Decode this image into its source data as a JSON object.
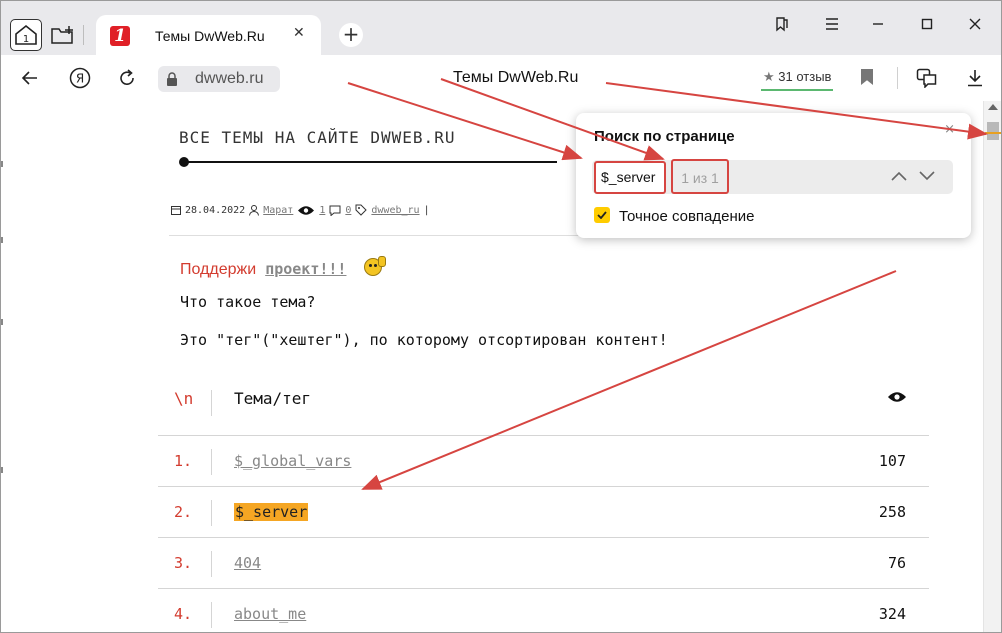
{
  "browser": {
    "tab": {
      "title": "Темы DwWeb.Ru",
      "favicon_char": "1",
      "close": "✕"
    },
    "home_badge": "1",
    "new_tab_symbol": "+",
    "address": {
      "url": "dwweb.ru",
      "page_title": "Темы DwWeb.Ru"
    },
    "rating": {
      "star": "★",
      "text": "31 отзыв"
    },
    "accent_color": "#e02027"
  },
  "page": {
    "header": "ВСЕ ТЕМЫ НА САЙТЕ DWWEB.RU",
    "meta": {
      "date": "28.04.2022",
      "author": "Марат",
      "views": "1",
      "comments": "0",
      "tag": "dwweb_ru",
      "sep": "|"
    },
    "support": {
      "text": "Поддержи",
      "link": "проект!!!"
    },
    "question": "Что такое тема?",
    "answer": "Это \"тег\"(\"хештег\"), по которому отсортирован контент!",
    "table": {
      "head_num": "\\n",
      "head_tag": "Тема/тег",
      "rows": [
        {
          "num": "1.",
          "tag": "$_global_vars",
          "count": "107"
        },
        {
          "num": "2.",
          "tag": "$_server",
          "count": "258",
          "highlighted": true
        },
        {
          "num": "3.",
          "tag": "404",
          "count": "76"
        },
        {
          "num": "4.",
          "tag": "about_me",
          "count": "324"
        }
      ]
    }
  },
  "find_panel": {
    "title": "Поиск по странице",
    "close": "×",
    "query": "$_server",
    "count": "1 из 1",
    "exact_match_label": "Точное совпадение",
    "exact_match_checked": true,
    "highlight_color": "#f5a623",
    "annotation_color": "#d64541"
  }
}
